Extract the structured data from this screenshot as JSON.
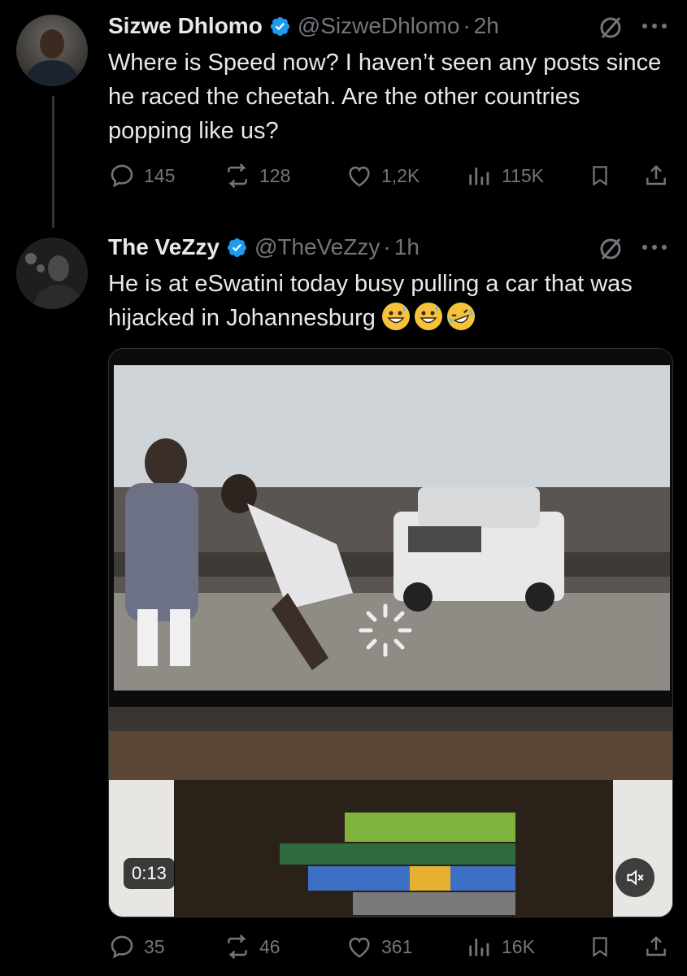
{
  "tweets": [
    {
      "display_name": "Sizwe Dhlomo",
      "handle": "@SizweDhlomo",
      "separator": "·",
      "time": "2h",
      "text": "Where is Speed now? I haven’t seen any posts since he raced the cheetah. Are the other countries popping like us?",
      "replies": "145",
      "reposts": "128",
      "likes": "1,2K",
      "views": "115K"
    },
    {
      "display_name": "The VeZzy",
      "handle": "@TheVeZzy",
      "separator": "·",
      "time": "1h",
      "text": "He is at eSwatini today busy pulling a car that was hijacked in Johannesburg",
      "emojis": [
        "grinning-face-with-sweat",
        "grinning-face-with-sweat",
        "rolling-on-the-floor-laughing"
      ],
      "video_duration": "0:13",
      "replies": "35",
      "reposts": "46",
      "likes": "361",
      "views": "16K"
    }
  ],
  "icons": {
    "verified": "verified-badge-icon",
    "grok": "grok-icon",
    "more": "more-icon",
    "reply": "reply-icon",
    "repost": "repost-icon",
    "like": "heart-icon",
    "views": "views-chart-icon",
    "bookmark": "bookmark-icon",
    "share": "share-icon",
    "mute": "speaker-muted-icon"
  },
  "colors": {
    "background": "#000000",
    "text": "#e7e9ea",
    "muted": "#71767b",
    "verified": "#1d9bf0"
  }
}
